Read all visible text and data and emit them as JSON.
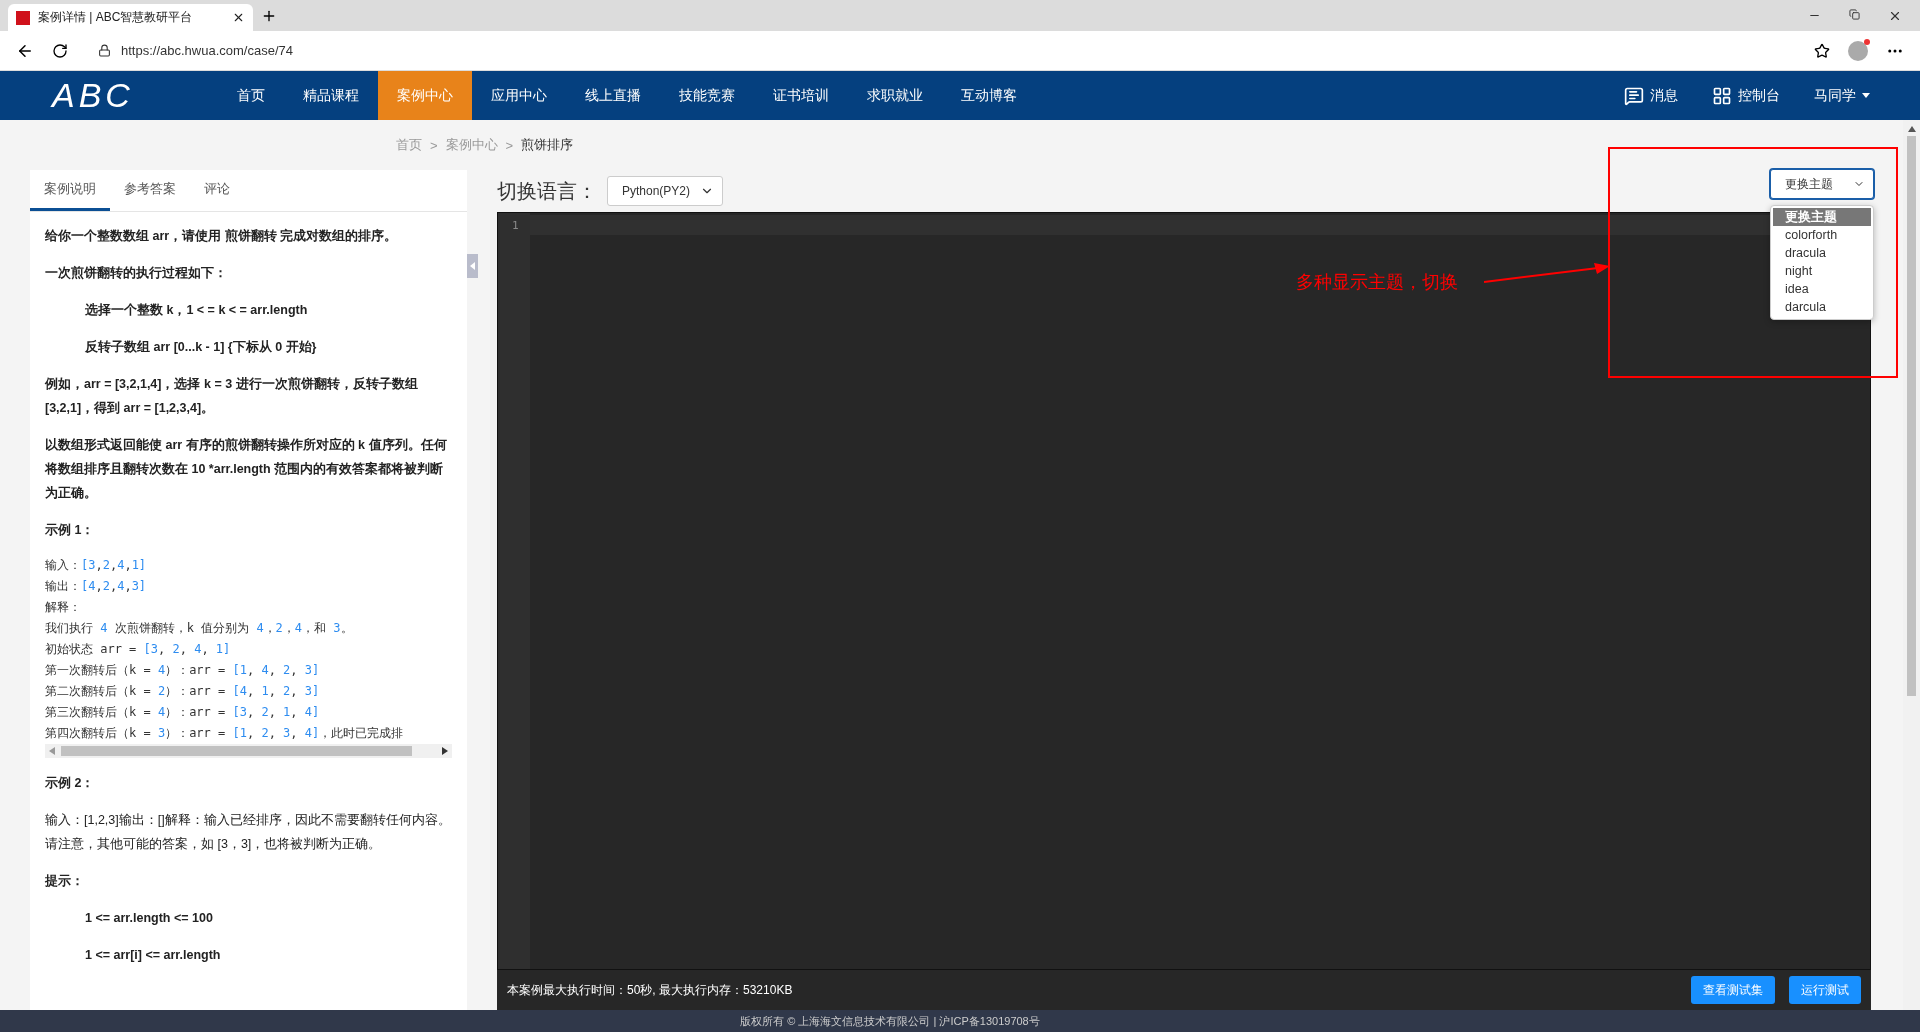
{
  "browser": {
    "tab_title": "案例详情 | ABC智慧教研平台",
    "url": "https://abc.hwua.com/case/74"
  },
  "nav": {
    "logo": "ABC",
    "items": [
      {
        "label": "首页",
        "selected": false
      },
      {
        "label": "精品课程",
        "selected": false
      },
      {
        "label": "案例中心",
        "selected": true
      },
      {
        "label": "应用中心",
        "selected": false
      },
      {
        "label": "线上直播",
        "selected": false
      },
      {
        "label": "技能竞赛",
        "selected": false
      },
      {
        "label": "证书培训",
        "selected": false
      },
      {
        "label": "求职就业",
        "selected": false
      },
      {
        "label": "互动博客",
        "selected": false
      }
    ],
    "messages": "消息",
    "console": "控制台",
    "user": "马同学"
  },
  "breadcrumb": {
    "separator": ">",
    "items": [
      "首页",
      "案例中心",
      "煎饼排序"
    ]
  },
  "panel": {
    "tabs": [
      {
        "label": "案例说明",
        "selected": true
      },
      {
        "label": "参考答案",
        "selected": false
      },
      {
        "label": "评论",
        "selected": false
      }
    ],
    "blocks": [
      {
        "kind": "para",
        "text": "给你一个整数数组 arr，请使用 煎饼翻转 完成对数组的排序。"
      },
      {
        "kind": "para",
        "text": "一次煎饼翻转的执行过程如下："
      },
      {
        "kind": "indent",
        "text": "选择一个整数 k，1 < = k < = arr.length"
      },
      {
        "kind": "indent",
        "text": "反转子数组 arr [0...k - 1] {下标从 0 开始}"
      },
      {
        "kind": "para",
        "text": "例如，arr = [3,2,1,4]，选择 k = 3 进行一次煎饼翻转，反转子数组 [3,2,1]，得到 arr = [1,2,3,4]。"
      },
      {
        "kind": "para",
        "text": "以数组形式返回能使 arr 有序的煎饼翻转操作所对应的 k 值序列。任何将数组排序且翻转次数在 10 *arr.length 范围内的有效答案都将被判断为正确。"
      },
      {
        "kind": "para",
        "text": "示例 1："
      },
      {
        "kind": "code",
        "lines": [
          "输入：[3,2,4,1]",
          "输出：[4,2,4,3]",
          "解释：",
          "我们执行 4 次煎饼翻转，k 值分别为 4，2，4，和 3。",
          "初始状态 arr = [3, 2, 4, 1]",
          "第一次翻转后（k = 4）：arr = [1, 4, 2, 3]",
          "第二次翻转后（k = 2）：arr = [4, 1, 2, 3]",
          "第三次翻转后（k = 4）：arr = [3, 2, 1, 4]",
          "第四次翻转后（k = 3）：arr = [1, 2, 3, 4]，此时已完成排"
        ]
      },
      {
        "kind": "para",
        "text": "示例 2："
      },
      {
        "kind": "plain",
        "text": "输入：[1,2,3]输出：[]解释：输入已经排序，因此不需要翻转任何内容。请注意，其他可能的答案，如 [3，3]，也将被判断为正确。"
      },
      {
        "kind": "para",
        "text": "提示："
      },
      {
        "kind": "indent",
        "text": "1 <= arr.length <= 100"
      },
      {
        "kind": "indent",
        "text": "1 <= arr[i] <= arr.length"
      }
    ]
  },
  "editor": {
    "language_label": "切换语言：",
    "language": "Python(PY2)",
    "line_numbers": [
      "1"
    ],
    "theme_select": {
      "value": "更换主题",
      "options": [
        {
          "label": "更换主题",
          "selected": true
        },
        {
          "label": "colorforth",
          "selected": false
        },
        {
          "label": "dracula",
          "selected": false
        },
        {
          "label": "night",
          "selected": false
        },
        {
          "label": "idea",
          "selected": false
        },
        {
          "label": "darcula",
          "selected": false
        }
      ]
    },
    "limits": "本案例最大执行时间：50秒, 最大执行内存：53210KB",
    "buttons": [
      "查看测试集",
      "运行测试"
    ]
  },
  "annotation": {
    "text": "多种显示主题，切换"
  },
  "footer": "版权所有 © 上海海文信息技术有限公司 | 沪ICP备13019708号"
}
